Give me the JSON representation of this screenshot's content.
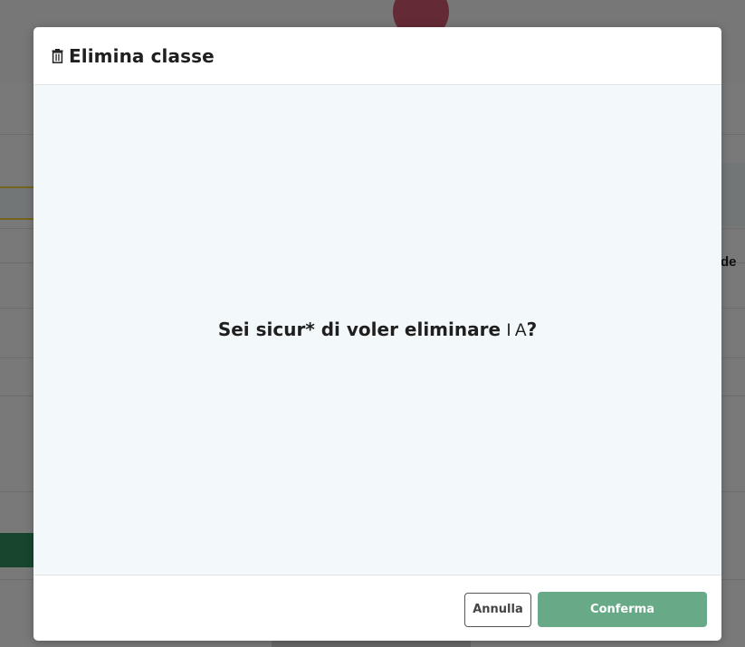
{
  "modal": {
    "title": "Elimina classe",
    "icon": "trash-icon",
    "question_prefix": "Sei sicur* di voler eliminare",
    "class_name": "I A",
    "question_suffix": "?",
    "cancel_label": "Annulla",
    "confirm_label": "Conferma",
    "confirm_color": "#68a987",
    "body_background": "#f3f9fa"
  },
  "background": {
    "partial_text": "de"
  }
}
